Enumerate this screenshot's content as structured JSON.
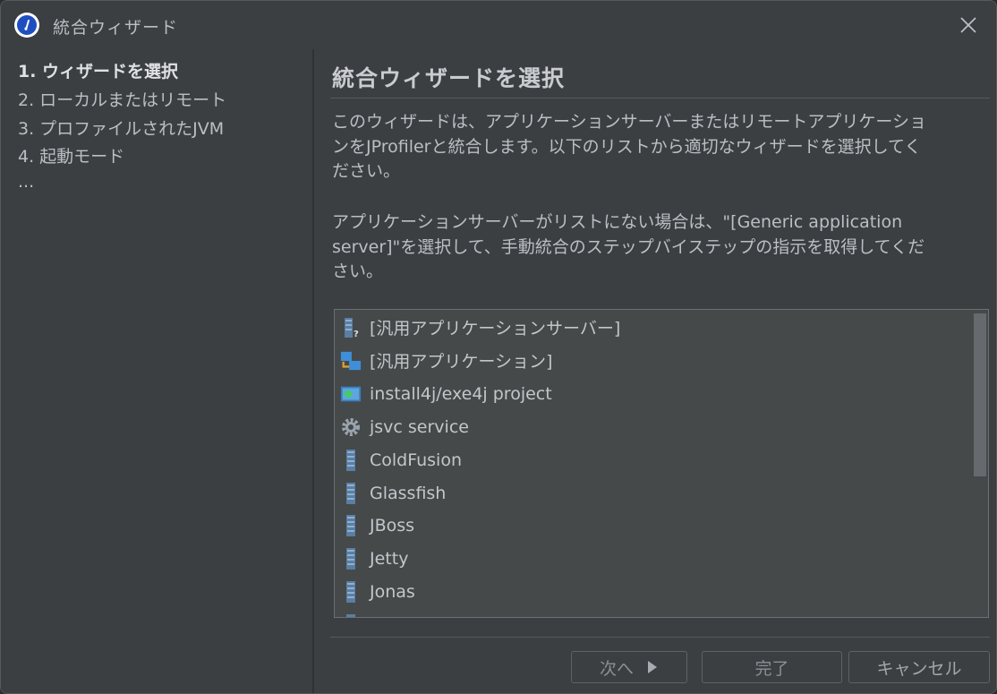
{
  "window": {
    "title": "統合ウィザード"
  },
  "steps": [
    {
      "label": "1. ウィザードを選択",
      "active": true
    },
    {
      "label": "2. ローカルまたはリモート",
      "active": false
    },
    {
      "label": "3. プロファイルされたJVM",
      "active": false
    },
    {
      "label": "4. 起動モード",
      "active": false
    },
    {
      "label": "...",
      "active": false
    }
  ],
  "main": {
    "heading": "統合ウィザードを選択",
    "paragraph1_line1": "このウィザードは、アプリケーションサーバーまたはリモートアプリケーショ",
    "paragraph1_line2": "ンをJProfilerと統合します。以下のリストから適切なウィザードを選択してく",
    "paragraph1_line3": "ださい。",
    "paragraph2_line1": "アプリケーションサーバーがリストにない場合は、\"[Generic application",
    "paragraph2_line2": "server]\"を選択して、手動統合のステップバイステップの指示を取得してくだ",
    "paragraph2_line3": "さい。"
  },
  "list": {
    "items": [
      {
        "label": "[汎用アプリケーションサーバー]",
        "icon": "generic-server-icon"
      },
      {
        "label": "[汎用アプリケーション]",
        "icon": "generic-application-icon"
      },
      {
        "label": "install4j/exe4j project",
        "icon": "install4j-icon"
      },
      {
        "label": "jsvc service",
        "icon": "gear-icon"
      },
      {
        "label": "ColdFusion",
        "icon": "server-icon"
      },
      {
        "label": "Glassfish",
        "icon": "server-icon"
      },
      {
        "label": "JBoss",
        "icon": "server-icon"
      },
      {
        "label": "Jetty",
        "icon": "server-icon"
      },
      {
        "label": "Jonas",
        "icon": "server-icon"
      }
    ]
  },
  "buttons": {
    "next": "次へ",
    "finish": "完了",
    "cancel": "キャンセル"
  },
  "colors": {
    "background": "#3c3f41",
    "list_background": "#45494a",
    "text": "#bcbec4",
    "disabled_text": "#8c8f94"
  }
}
